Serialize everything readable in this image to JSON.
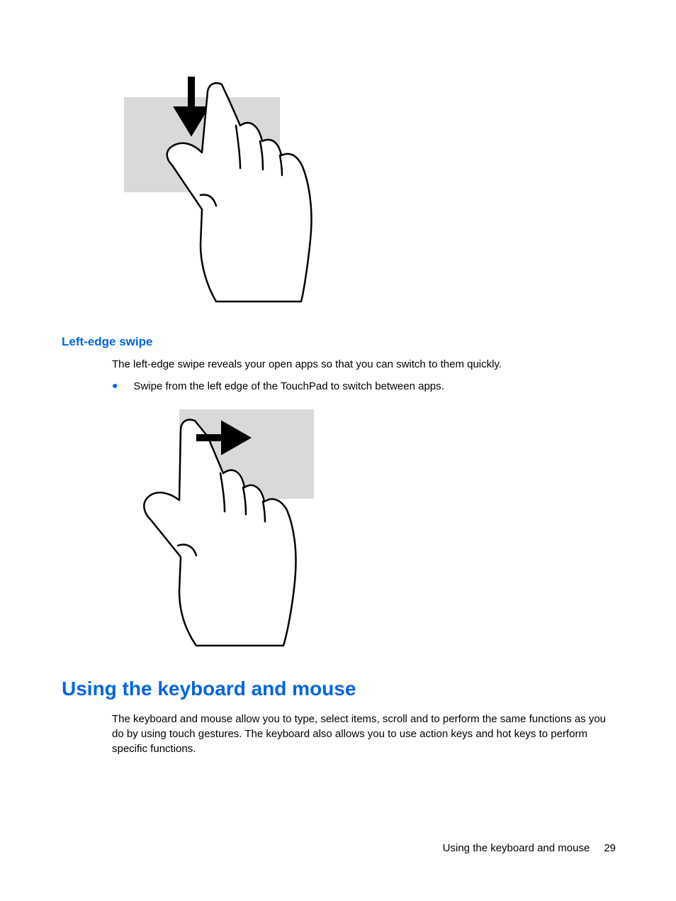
{
  "headings": {
    "left_edge_swipe": "Left-edge swipe",
    "using_keyboard_mouse": "Using the keyboard and mouse"
  },
  "body": {
    "left_edge_intro": "The left-edge swipe reveals your open apps so that you can switch to them quickly.",
    "left_edge_bullet": "Swipe from the left edge of the TouchPad to switch between apps.",
    "keyboard_mouse_intro": "The keyboard and mouse allow you to type, select items, scroll and to perform the same functions as you do by using touch gestures. The keyboard also allows you to use action keys and hot keys to perform specific functions."
  },
  "footer": {
    "section": "Using the keyboard and mouse",
    "page_number": "29"
  }
}
